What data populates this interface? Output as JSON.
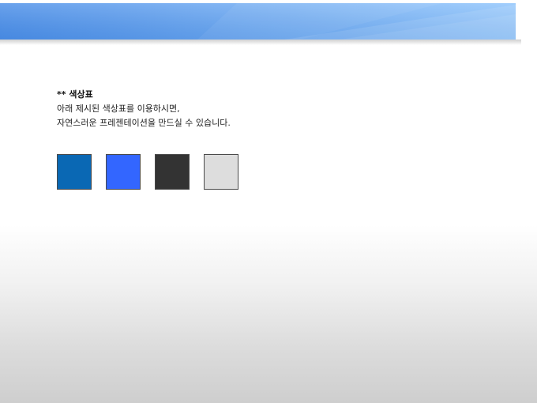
{
  "banner": {
    "color_left": "#4A8EE8",
    "color_right": "#8EC4FC"
  },
  "slide": {
    "heading": "** 색상표",
    "lines": [
      "아래 제시된 색상표를 이용하시면,",
      "자연스러운 프레젠테이션을 만드실 수 있습니다."
    ]
  },
  "palette": [
    {
      "color": "#0A68B4"
    },
    {
      "color": "#3366FF"
    },
    {
      "color": "#333333"
    },
    {
      "color": "#DDDDDD"
    }
  ]
}
